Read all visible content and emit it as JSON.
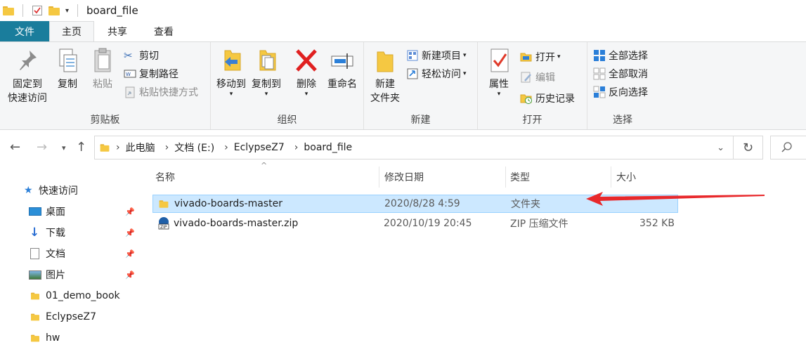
{
  "window": {
    "title": "board_file"
  },
  "ribbon_tabs": [
    "文件",
    "主页",
    "共享",
    "查看"
  ],
  "clipboard": {
    "pin_label_1": "固定到",
    "pin_label_2": "快速访问",
    "copy_label": "复制",
    "paste_label": "粘贴",
    "cut_label": "剪切",
    "copy_path_label": "复制路径",
    "paste_shortcut_label": "粘贴快捷方式",
    "group_label": "剪贴板"
  },
  "organize": {
    "move_to_label": "移动到",
    "copy_to_label": "复制到",
    "delete_label": "删除",
    "rename_label": "重命名",
    "group_label": "组织"
  },
  "new_group": {
    "new_folder_1": "新建",
    "new_folder_2": "文件夹",
    "new_item_label": "新建项目",
    "easy_access_label": "轻松访问",
    "group_label": "新建"
  },
  "open_group": {
    "properties_label": "属性",
    "open_label": "打开",
    "edit_label": "编辑",
    "history_label": "历史记录",
    "group_label": "打开"
  },
  "select_group": {
    "select_all_label": "全部选择",
    "select_none_label": "全部取消",
    "invert_label": "反向选择",
    "group_label": "选择"
  },
  "breadcrumb": [
    "此电脑",
    "文档 (E:)",
    "EclypseZ7",
    "board_file"
  ],
  "nav": [
    {
      "label": "快速访问",
      "icon": "star-icon"
    },
    {
      "label": "桌面",
      "icon": "desktop-icon",
      "pinned": true
    },
    {
      "label": "下载",
      "icon": "download-icon",
      "pinned": true
    },
    {
      "label": "文档",
      "icon": "document-icon",
      "pinned": true
    },
    {
      "label": "图片",
      "icon": "picture-icon",
      "pinned": true
    },
    {
      "label": "01_demo_book",
      "icon": "folder-icon"
    },
    {
      "label": "EclypseZ7",
      "icon": "folder-icon"
    },
    {
      "label": "hw",
      "icon": "folder-icon"
    }
  ],
  "columns": [
    "名称",
    "修改日期",
    "类型",
    "大小"
  ],
  "files": [
    {
      "name": "vivado-boards-master",
      "date": "2020/8/28 4:59",
      "type": "文件夹",
      "size": "",
      "icon": "folder-icon",
      "selected": true
    },
    {
      "name": "vivado-boards-master.zip",
      "date": "2020/10/19 20:45",
      "type": "ZIP 压缩文件",
      "size": "352 KB",
      "icon": "zip-icon",
      "selected": false
    }
  ],
  "colors": {
    "accent": "#1a7d9c",
    "selection": "#cce8ff",
    "arrow": "#e8282b",
    "folder": "#f5c842"
  }
}
